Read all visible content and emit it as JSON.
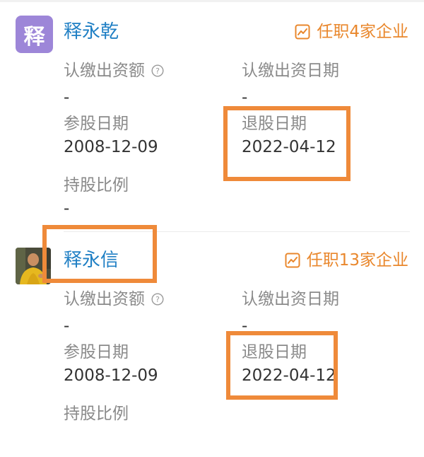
{
  "colors": {
    "name": "#1f7fc4",
    "accent_orange": "#e9872c",
    "label": "#8a8a8a",
    "value": "#333333",
    "highlight": "#ef8a3a",
    "avatar_purple": "#9d86d8",
    "divider": "#ebebeb"
  },
  "shareholders": [
    {
      "avatar_text": "释",
      "name": "释永乾",
      "positions": "任职4家企业",
      "positions_icon": "trend-chart-icon",
      "fields": {
        "subscribed_capital": {
          "label": "认缴出资额",
          "value": "-",
          "help_icon": "question-circle-icon"
        },
        "subscribed_date": {
          "label": "认缴出资日期",
          "value": "-"
        },
        "join_date": {
          "label": "参股日期",
          "value": "2008-12-09"
        },
        "exit_date": {
          "label": "退股日期",
          "value": "2022-04-12"
        },
        "share_ratio": {
          "label": "持股比例",
          "value": "-"
        }
      }
    },
    {
      "avatar_icon": "monk-photo-avatar",
      "name": "释永信",
      "positions": "任职13家企业",
      "positions_icon": "trend-chart-icon",
      "fields": {
        "subscribed_capital": {
          "label": "认缴出资额",
          "value": "-",
          "help_icon": "question-circle-icon"
        },
        "subscribed_date": {
          "label": "认缴出资日期",
          "value": "-"
        },
        "join_date": {
          "label": "参股日期",
          "value": "2008-12-09"
        },
        "exit_date": {
          "label": "退股日期",
          "value": "2022-04-12"
        },
        "share_ratio": {
          "label": "持股比例"
        }
      }
    }
  ]
}
